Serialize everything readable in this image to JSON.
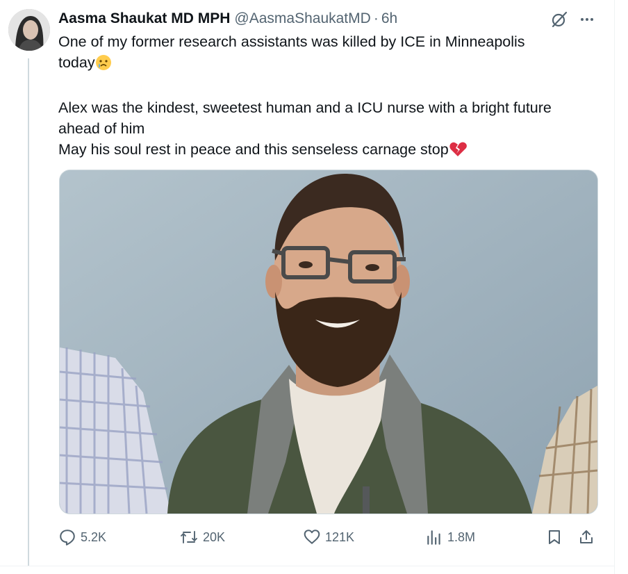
{
  "tweet": {
    "author_name": "Aasma Shaukat MD MPH",
    "handle": "@AasmaShaukatMD",
    "separator": "·",
    "time": "6h",
    "lines": [
      "One of my former research assistants was killed by ICE in Minneapolis",
      "today"
    ],
    "para2": [
      "Alex was the kindest, sweetest human and a ICU nurse with a bright future",
      "ahead of him",
      "May his soul rest in peace  and this senseless carnage stop"
    ]
  },
  "actions": {
    "replies": "5.2K",
    "reposts": "20K",
    "likes": "121K",
    "views": "1.8M"
  },
  "icons": {
    "reply": "reply-icon",
    "repost": "repost-icon",
    "like": "heart-icon",
    "views": "views-icon",
    "bookmark": "bookmark-icon",
    "share": "share-icon",
    "grok": "grok-icon",
    "more": "more-icon",
    "emoji_cry": "crying-face-emoji",
    "emoji_broken": "broken-heart-emoji"
  },
  "colors": {
    "text": "#0f1419",
    "secondary": "#536471",
    "border": "#cfd9de"
  }
}
